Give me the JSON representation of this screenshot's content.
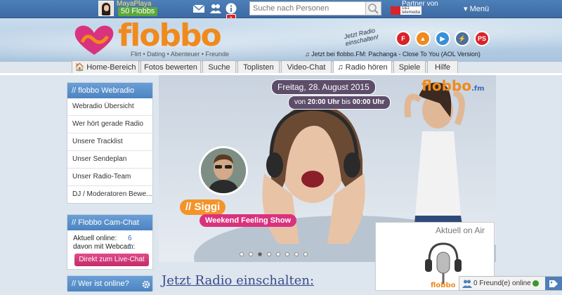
{
  "topbar": {
    "username": "MayaPlaya",
    "flobbs": "50 Flobbs",
    "notification_count": "1",
    "search_placeholder": "Suche nach Personen",
    "partner_label": "Partner von",
    "menu_label": "▾ Menü",
    "icons": [
      "mail-icon",
      "friends-icon",
      "info-icon",
      "search-icon"
    ]
  },
  "header": {
    "logo": "flobbo",
    "tagline": "Flirt • Dating • Abenteuer • Freunde",
    "radio_cta": "Jetzt Radio einschalten!",
    "now_playing": "♫ Jetzt bei flobbo.FM: Pachanga - Close To You (AOL Version)",
    "player_buttons": [
      {
        "name": "flash-player",
        "label": "F",
        "color": "#d8232a"
      },
      {
        "name": "vlc-player",
        "label": "▲",
        "color": "#f08a1c"
      },
      {
        "name": "media-player",
        "label": "▶",
        "color": "#3a8fd6"
      },
      {
        "name": "winamp-player",
        "label": "⚡",
        "color": "#4d6f9a"
      },
      {
        "name": "ps-player",
        "label": "PS",
        "color": "#d8232a"
      }
    ]
  },
  "nav": {
    "tabs": [
      {
        "label": "🏠 Home-Bereich"
      },
      {
        "label": "Fotos bewerten"
      },
      {
        "label": "Suche"
      },
      {
        "label": "Toplisten"
      },
      {
        "label": "Video-Chat"
      },
      {
        "label": "♫ Radio hören"
      },
      {
        "label": "Spiele"
      },
      {
        "label": "Hilfe"
      }
    ]
  },
  "sidebar": {
    "webradio": {
      "title": "// flobbo Webradio",
      "items": [
        {
          "label": "Webradio Übersicht"
        },
        {
          "label": "Wer hört gerade Radio"
        },
        {
          "label": "Unsere Tracklist"
        },
        {
          "label": "Unser Sendeplan"
        },
        {
          "label": "Unser Radio-Team"
        },
        {
          "label": "DJ / Moderatoren Bewe..."
        }
      ]
    },
    "camchat": {
      "title": "// Flobbo Cam-Chat",
      "online_label": "Aktuell online:",
      "online_count": "6",
      "webcam_label": "davon mit Webcam:",
      "webcam_count": "1",
      "button": "Direkt zum Live-Chat"
    },
    "whoonline": {
      "title": "// Wer ist online?"
    }
  },
  "hero": {
    "date": "Freitag, 28. August 2015",
    "time_from_label": "von",
    "time_from": "20:00 Uhr",
    "time_to_label": "bis",
    "time_to": "00:00 Uhr",
    "fm_logo": "flobbo",
    "fm_suffix": ".fm",
    "dj_name": "// Siggi",
    "show_name": "Weekend Feeling Show",
    "slide_count": "8",
    "active_slide": "3"
  },
  "onair": {
    "title": "Aktuell on Air"
  },
  "bottom": {
    "title": "Jetzt Radio einschalten:"
  },
  "friends": {
    "label": "0 Freund(e) online"
  }
}
